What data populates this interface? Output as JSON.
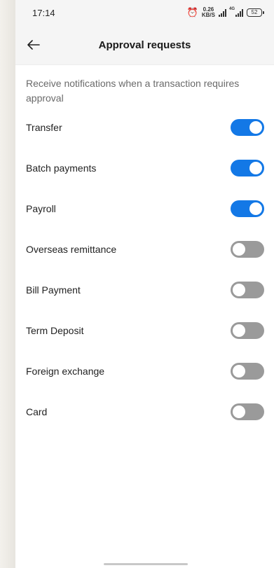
{
  "status_bar": {
    "time": "17:14",
    "net_speed_value": "0.26",
    "net_speed_unit": "KB/S",
    "network_tag": "4G",
    "battery": "52"
  },
  "header": {
    "title": "Approval requests"
  },
  "description": "Receive notifications when a transaction requires approval",
  "items": [
    {
      "label": "Transfer",
      "enabled": true
    },
    {
      "label": "Batch payments",
      "enabled": true
    },
    {
      "label": "Payroll",
      "enabled": true
    },
    {
      "label": "Overseas remittance",
      "enabled": false
    },
    {
      "label": "Bill Payment",
      "enabled": false
    },
    {
      "label": "Term Deposit",
      "enabled": false
    },
    {
      "label": "Foreign exchange",
      "enabled": false
    },
    {
      "label": "Card",
      "enabled": false
    }
  ],
  "colors": {
    "toggle_on": "#1378e6",
    "toggle_off": "#9a9a9a"
  }
}
